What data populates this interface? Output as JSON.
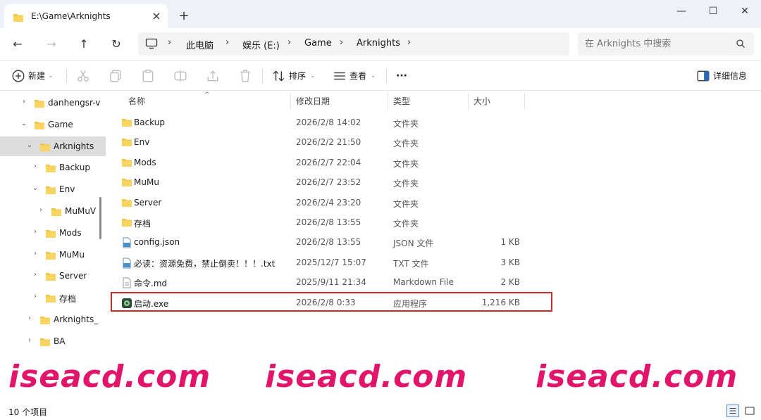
{
  "window": {
    "tab_title": "E:\\Game\\Arknights",
    "tab_close": "×",
    "new_tab": "+",
    "minimize": "—",
    "maximize": "☐",
    "close": "✕"
  },
  "nav": {
    "back": "←",
    "forward": "→",
    "up": "↑",
    "refresh": "↻",
    "breadcrumbs": [
      "此电脑",
      "娱乐 (E:)",
      "Game",
      "Arknights"
    ],
    "separator": "›",
    "search_placeholder": "在 Arknights 中搜索"
  },
  "toolbar": {
    "new_label": "新建",
    "sort_label": "排序",
    "view_label": "查看",
    "more_label": "···",
    "details_label": "详细信息"
  },
  "sidebar": {
    "items": [
      {
        "label": "danhengsr-v",
        "level": 1,
        "expanded": false
      },
      {
        "label": "Game",
        "level": 1,
        "expanded": true
      },
      {
        "label": "Arknights",
        "level": 2,
        "expanded": true,
        "selected": true
      },
      {
        "label": "Backup",
        "level": 3,
        "expanded": false
      },
      {
        "label": "Env",
        "level": 3,
        "expanded": true
      },
      {
        "label": "MuMuV",
        "level": 4,
        "expanded": false
      },
      {
        "label": "Mods",
        "level": 3,
        "expanded": false
      },
      {
        "label": "MuMu",
        "level": 3,
        "expanded": false
      },
      {
        "label": "Server",
        "level": 3,
        "expanded": false
      },
      {
        "label": "存档",
        "level": 3,
        "expanded": false
      },
      {
        "label": "Arknights_",
        "level": 2,
        "expanded": false
      },
      {
        "label": "BA",
        "level": 2,
        "expanded": false
      }
    ]
  },
  "columns": {
    "name": "名称",
    "date": "修改日期",
    "type": "类型",
    "size": "大小"
  },
  "files": [
    {
      "name": "Backup",
      "date": "2026/2/8 14:02",
      "type": "文件夹",
      "size": "",
      "icon": "folder"
    },
    {
      "name": "Env",
      "date": "2026/2/2 21:50",
      "type": "文件夹",
      "size": "",
      "icon": "folder"
    },
    {
      "name": "Mods",
      "date": "2026/2/7 22:04",
      "type": "文件夹",
      "size": "",
      "icon": "folder"
    },
    {
      "name": "MuMu",
      "date": "2026/2/7 23:52",
      "type": "文件夹",
      "size": "",
      "icon": "folder"
    },
    {
      "name": "Server",
      "date": "2026/2/4 23:20",
      "type": "文件夹",
      "size": "",
      "icon": "folder"
    },
    {
      "name": "存档",
      "date": "2026/2/8 13:55",
      "type": "文件夹",
      "size": "",
      "icon": "folder"
    },
    {
      "name": "config.json",
      "date": "2026/2/8 13:55",
      "type": "JSON 文件",
      "size": "1 KB",
      "icon": "json"
    },
    {
      "name": "必读：资源免费，禁止倒卖！！！.txt",
      "date": "2025/12/7 15:07",
      "type": "TXT 文件",
      "size": "3 KB",
      "icon": "txt"
    },
    {
      "name": "命令.md",
      "date": "2025/9/11 21:34",
      "type": "Markdown File",
      "size": "2 KB",
      "icon": "md"
    },
    {
      "name": "启动.exe",
      "date": "2026/2/8 0:33",
      "type": "应用程序",
      "size": "1,216 KB",
      "icon": "exe"
    }
  ],
  "watermark": "iseacd.com",
  "status": {
    "count": "10 个项目"
  },
  "colors": {
    "folder": "#f4c542",
    "highlight": "#d22a2a",
    "watermark": "#e3156a"
  }
}
